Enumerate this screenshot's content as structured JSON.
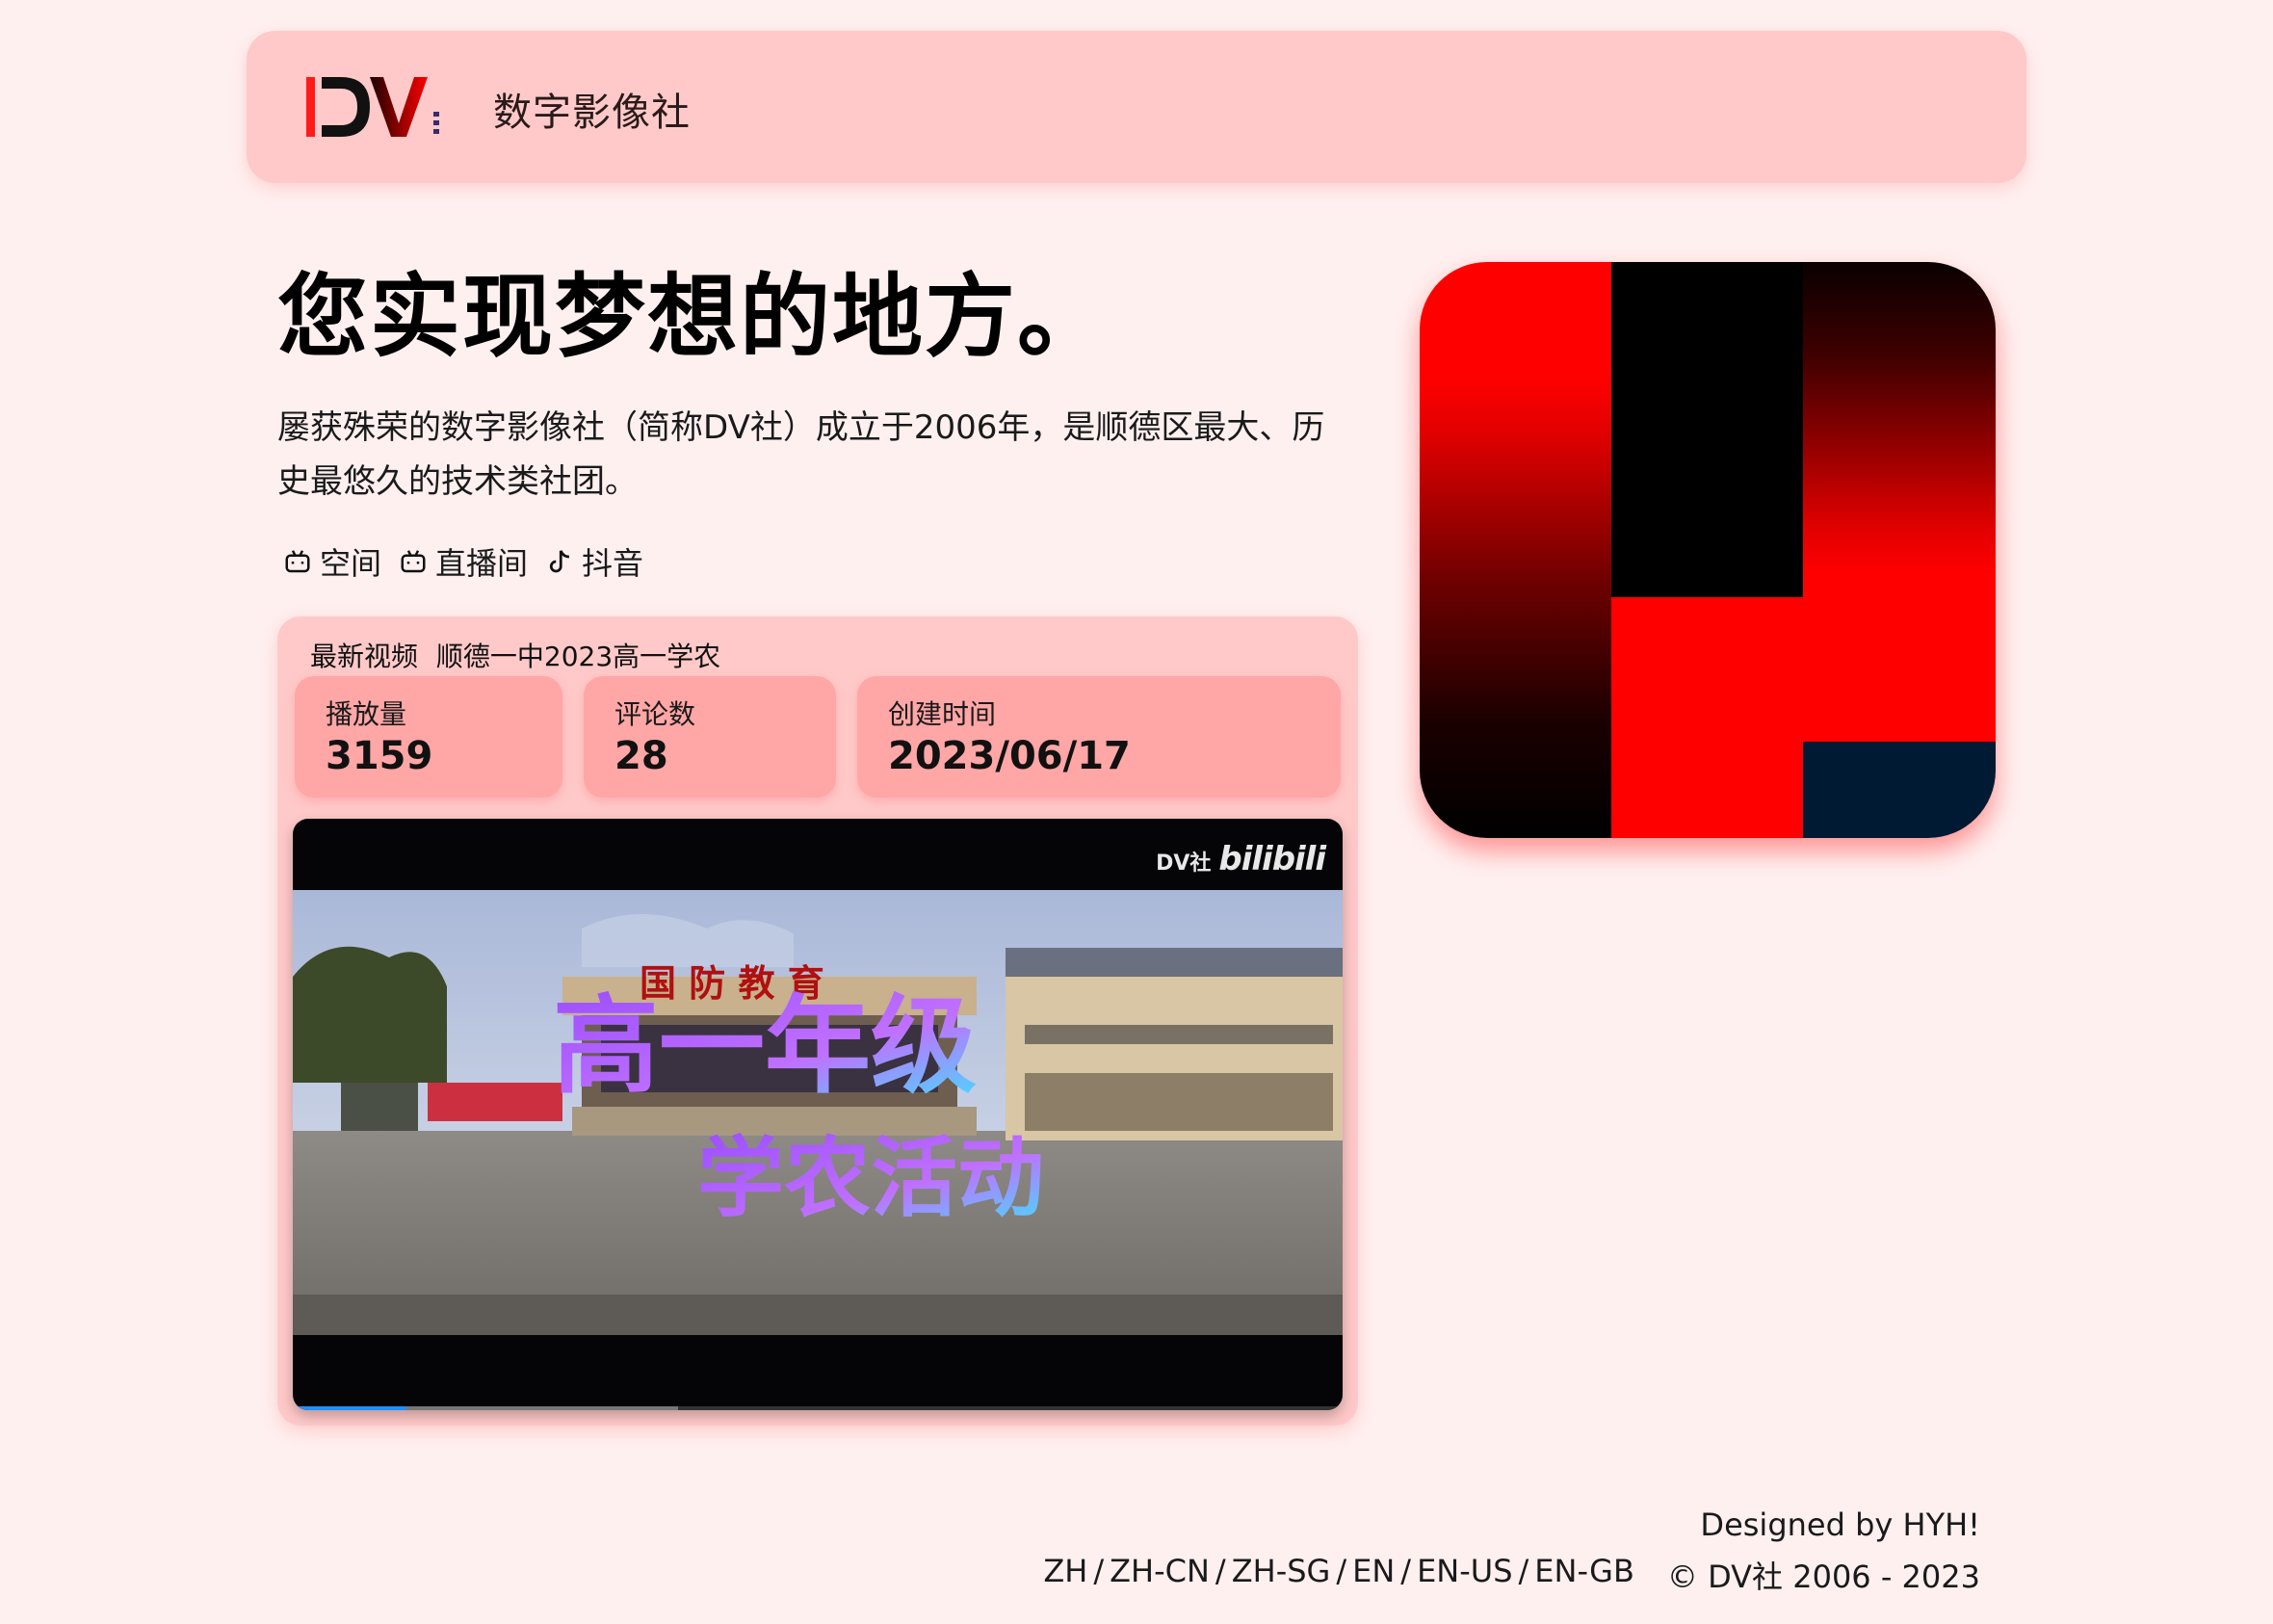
{
  "header": {
    "logo_text": "DV",
    "brand": "数字影像社"
  },
  "hero": {
    "title": "您实现梦想的地方。",
    "description": "屡获殊荣的数字影像社（简称DV社）成立于2006年，是顺德区最大、历史最悠久的技术类社团。"
  },
  "social": [
    {
      "icon": "bilibili-icon",
      "label": "空间"
    },
    {
      "icon": "bilibili-icon",
      "label": "直播间"
    },
    {
      "icon": "tiktok-icon",
      "label": "抖音"
    }
  ],
  "latest_video": {
    "prefix": "最新视频",
    "title": "顺德一中2023高一学农",
    "stats": [
      {
        "label": "播放量",
        "value": "3159"
      },
      {
        "label": "评论数",
        "value": "28"
      },
      {
        "label": "创建时间",
        "value": "2023/06/17"
      }
    ],
    "player": {
      "watermark_club": "DV社",
      "watermark_site": "bilibili",
      "scene_sign": "国 防   教 育",
      "overlay_line1": "高一年级",
      "overlay_line2": "学农活动",
      "progress_played": 0.108,
      "progress_buffered": 0.367
    }
  },
  "colors": {
    "background": "#fff0f0",
    "header_bg": "#ffc9c9",
    "stat_bg": "#ffa6a6",
    "accent_red": "#ff0000"
  },
  "footer": {
    "designed_by": "Designed by HYH!",
    "languages": [
      "ZH",
      "ZH-CN",
      "ZH-SG",
      "EN",
      "EN-US",
      "EN-GB"
    ],
    "copyright": "© DV社 2006 - 2023"
  }
}
